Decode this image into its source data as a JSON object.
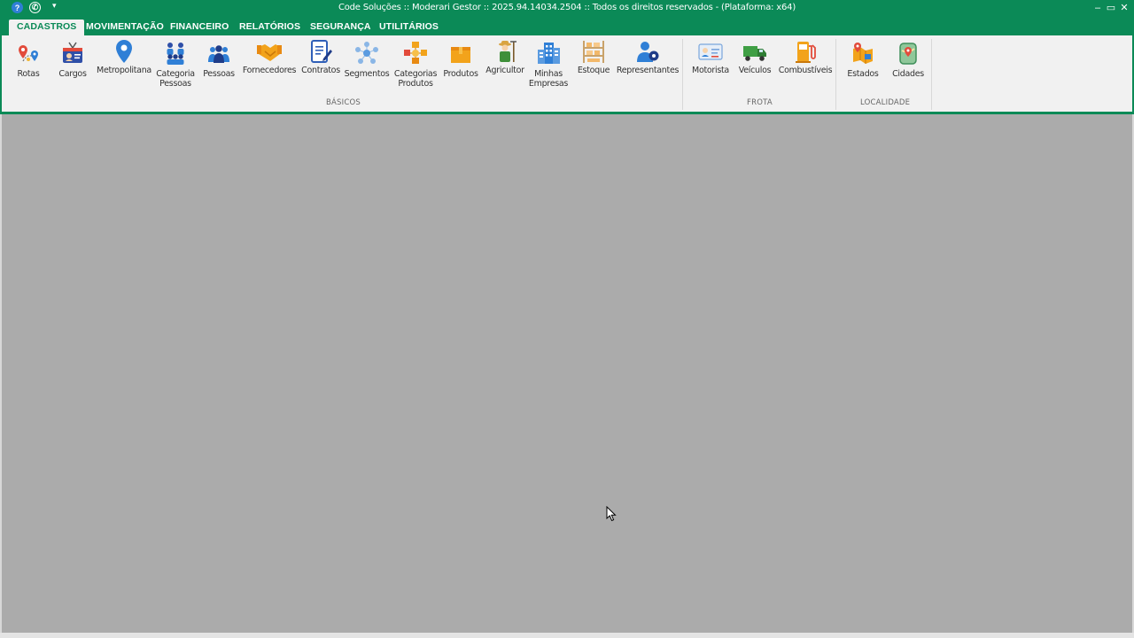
{
  "window": {
    "title": "Code Soluções :: Moderari Gestor :: 2025.94.14034.2504 :: Todos os direitos reservados - (Plataforma: x64)",
    "help_glyph": "?",
    "whatsapp_glyph": "✆",
    "qa_dropdown_glyph": "▾",
    "minimize_glyph": "–",
    "maximize_glyph": "▭",
    "close_glyph": "✕"
  },
  "tabs": [
    {
      "label": "CADASTROS",
      "active": true
    },
    {
      "label": "MOVIMENTAÇÃO"
    },
    {
      "label": "FINANCEIRO"
    },
    {
      "label": "RELATÓRIOS"
    },
    {
      "label": "SEGURANÇA"
    },
    {
      "label": "UTILITÁRIOS"
    }
  ],
  "ribbon": {
    "groups": {
      "basicos": "BÁSICOS",
      "frota": "FROTA",
      "localidade": "LOCALIDADE"
    },
    "buttons": {
      "rotas": {
        "label": "Rotas",
        "icon": "route-pins-icon"
      },
      "cargos": {
        "label": "Cargos",
        "icon": "id-badge-icon"
      },
      "metropolitana": {
        "label": "Metropolitana",
        "icon": "map-pin-icon"
      },
      "categoria_pessoas": {
        "label": "Categoria\nPessoas",
        "icon": "people-group-icon"
      },
      "pessoas": {
        "label": "Pessoas",
        "icon": "people-icon"
      },
      "fornecedores": {
        "label": "Fornecedores",
        "icon": "handshake-icon"
      },
      "contratos": {
        "label": "Contratos",
        "icon": "contract-pen-icon"
      },
      "segmentos": {
        "label": "Segmentos",
        "icon": "network-nodes-icon"
      },
      "categorias_produtos": {
        "label": "Categorias\nProdutos",
        "icon": "boxes-hub-icon"
      },
      "produtos": {
        "label": "Produtos",
        "icon": "box-icon"
      },
      "agricultor": {
        "label": "Agricultor",
        "icon": "farmer-icon"
      },
      "minhas_empresas": {
        "label": "Minhas\nEmpresas",
        "icon": "buildings-icon"
      },
      "estoque": {
        "label": "Estoque",
        "icon": "shelves-icon"
      },
      "representantes": {
        "label": "Representantes",
        "icon": "representative-icon"
      },
      "motorista": {
        "label": "Motorista",
        "icon": "driver-license-icon"
      },
      "veiculos": {
        "label": "Veículos",
        "icon": "truck-icon"
      },
      "combustiveis": {
        "label": "Combustíveis",
        "icon": "fuel-pump-icon"
      },
      "estados": {
        "label": "Estados",
        "icon": "state-map-icon"
      },
      "cidades": {
        "label": "Cidades",
        "icon": "city-map-icon"
      }
    }
  },
  "colors": {
    "brand_green": "#0b8a57",
    "ribbon_bg": "#f1f1f1",
    "workspace_bg": "#ababab"
  }
}
